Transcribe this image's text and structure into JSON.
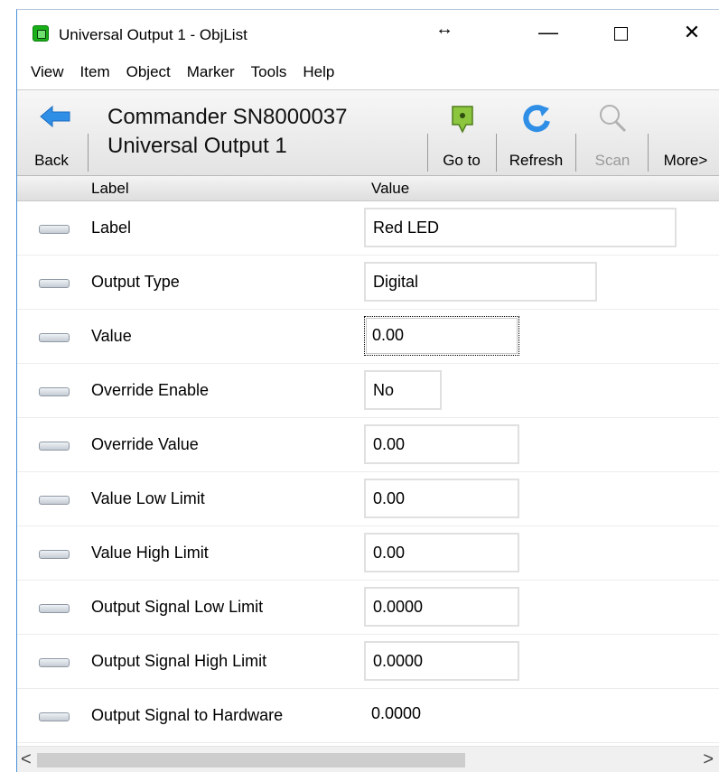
{
  "window": {
    "title": "Universal Output 1 - ObjList",
    "resize_glyph": "↔",
    "minimize_glyph": "—",
    "close_glyph": "✕"
  },
  "menu": [
    "View",
    "Item",
    "Object",
    "Marker",
    "Tools",
    "Help"
  ],
  "toolbar": {
    "back_label": "Back",
    "device_line1": "Commander SN8000037",
    "device_line2": "Universal Output 1",
    "goto_label": "Go to",
    "refresh_label": "Refresh",
    "scan_label": "Scan",
    "more_label": "More>"
  },
  "columns": {
    "label": "Label",
    "value": "Value"
  },
  "rows": [
    {
      "label": "Label",
      "value": "Red LED"
    },
    {
      "label": "Output Type",
      "value": "Digital"
    },
    {
      "label": "Value",
      "value": "0.00"
    },
    {
      "label": "Override Enable",
      "value": "No"
    },
    {
      "label": "Override Value",
      "value": "0.00"
    },
    {
      "label": "Value Low Limit",
      "value": "0.00"
    },
    {
      "label": "Value High Limit",
      "value": "0.00"
    },
    {
      "label": "Output Signal Low Limit",
      "value": "0.0000"
    },
    {
      "label": "Output Signal High Limit",
      "value": "0.0000"
    },
    {
      "label": "Output Signal to Hardware",
      "value": "0.0000"
    }
  ],
  "scrollbar": {
    "left_glyph": "<",
    "right_glyph": ">"
  },
  "colors": {
    "accent_blue": "#2f8ee6",
    "goto_green": "#8cc63f",
    "app_icon_green": "#18b018"
  }
}
